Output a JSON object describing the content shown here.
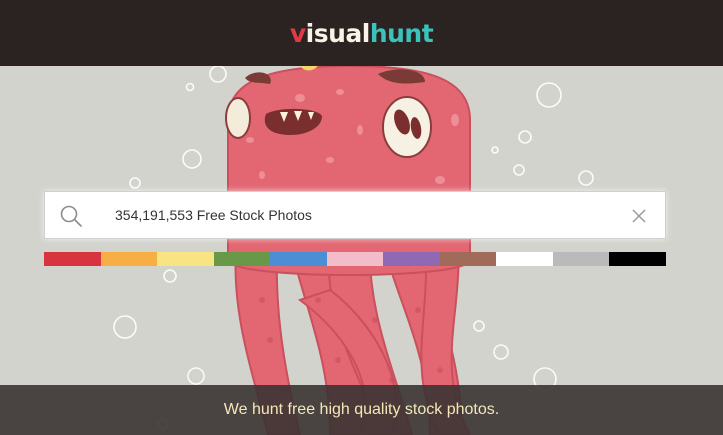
{
  "header": {
    "logo_part1": "v",
    "logo_part2": "isual",
    "logo_part3": "hunt"
  },
  "search": {
    "placeholder": "354,191,553 Free Stock Photos",
    "value": ""
  },
  "color_filters": [
    {
      "name": "red",
      "hex": "#d8343f"
    },
    {
      "name": "orange",
      "hex": "#f6ae45"
    },
    {
      "name": "yellow",
      "hex": "#f9e484"
    },
    {
      "name": "green",
      "hex": "#6a9849"
    },
    {
      "name": "blue",
      "hex": "#4a8fd6"
    },
    {
      "name": "pink",
      "hex": "#f2bccb"
    },
    {
      "name": "purple",
      "hex": "#8f69b4"
    },
    {
      "name": "brown",
      "hex": "#a16b5a"
    },
    {
      "name": "white",
      "hex": "#ffffff"
    },
    {
      "name": "gray",
      "hex": "#bababa"
    },
    {
      "name": "black",
      "hex": "#000000"
    }
  ],
  "footer": {
    "tagline": "We hunt free high quality stock photos."
  },
  "colors": {
    "topbar_bg": "#2b2321",
    "hero_bg": "#d3d3cd",
    "monster": "#e26772",
    "accent_teal": "#3bc3bb",
    "accent_red": "#e03a45"
  }
}
